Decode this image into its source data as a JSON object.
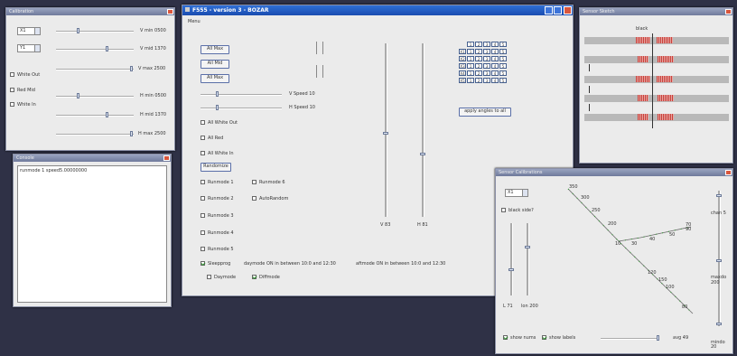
{
  "calibration": {
    "title": "Calibration",
    "selects": [
      "X1",
      "Y1"
    ],
    "slider_labels": [
      "V min 0500",
      "V mid 1370",
      "V max 2500",
      "H min 0500",
      "H mid 1370",
      "H max 2500"
    ],
    "checkboxes": [
      "White Out",
      "Red Mid",
      "White In"
    ]
  },
  "console": {
    "title": "Console",
    "text": "runmode 1 speed5.00000000"
  },
  "main": {
    "title": "F555 - version 3 - BOZAR",
    "menu": "Menu",
    "buttons": [
      "All Max",
      "All Mid",
      "All Max"
    ],
    "speeds": [
      "V Speed 10",
      "H Speed 10"
    ],
    "checkboxes": [
      "All White Out",
      "All Red",
      "All White In"
    ],
    "randomize": "Randomize",
    "runmodes": [
      "Runmode 1",
      "Runmode 2",
      "Runmode 3",
      "Runmode 4",
      "Runmode 5"
    ],
    "runmode6": "Runmode 6",
    "auto": "AutoRandom",
    "vlabel": "V 83",
    "hlabel": "H 81",
    "sleep": "Sleepprog",
    "daymode_note": "daymode ON in between 10:0 and 12:30",
    "aftermode_note": "aftmode ON in between 10:0 and 12:30",
    "daymode": "Daymode",
    "diffmode": "Diffmode",
    "apply": "apply angles to all"
  },
  "grid": {
    "rows": [
      [
        "1",
        "2",
        "3",
        "4",
        "5"
      ],
      [
        "X1",
        "1",
        "2",
        "3",
        "4",
        "5"
      ],
      [
        "X2",
        "1",
        "2",
        "3",
        "4",
        "5"
      ],
      [
        "X3",
        "1",
        "2",
        "3",
        "4",
        "5"
      ],
      [
        "X4",
        "1",
        "2",
        "3",
        "4",
        "5"
      ],
      [
        "X5",
        "1",
        "2",
        "3",
        "4",
        "5"
      ]
    ]
  },
  "sensor_sketch": {
    "title": "Sensor Sketch",
    "label": "black"
  },
  "sensor_cal": {
    "title": "Sensor Calibrations",
    "select": "X1",
    "black_side": "black side?",
    "lmin": "L 71",
    "lmax": "lon 200",
    "show_nums": "show nums",
    "show_labels": "show labels",
    "avg": "avg 49",
    "right_labels": [
      "chan 5",
      "maxdo 200",
      "mindo 20"
    ],
    "line_labels": [
      "350",
      "300",
      "250",
      "200",
      "10",
      "30",
      "40",
      "50",
      "70",
      "90",
      "120",
      "150",
      "100",
      "80"
    ]
  }
}
